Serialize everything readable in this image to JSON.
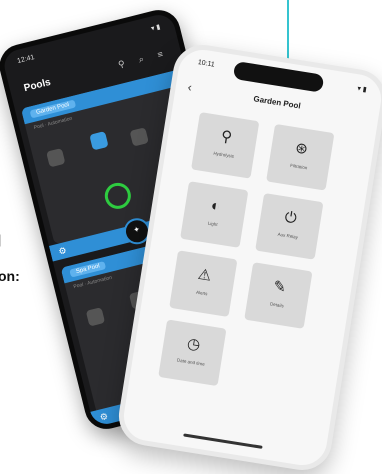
{
  "side_text": {
    "line1": "|",
    "line2": "on:"
  },
  "dark_phone": {
    "time": "12:41",
    "status_right": "▾ ▮",
    "title": "Pools",
    "header_icons": "⚲ ⌕ ≡",
    "card1": {
      "tag": "Garden Pool",
      "sub": "Pool · Automation"
    },
    "card2": {
      "tag": "Spa Pool",
      "sub": "Pool · Automation"
    },
    "ring_labels": [
      "",
      "",
      "",
      ""
    ],
    "settings_icon": "⚙",
    "fab_icon": "✦"
  },
  "light_phone": {
    "time": "10:11",
    "status_right": "▾ ▮",
    "back": "‹",
    "title": "Garden Pool",
    "tiles": [
      {
        "icon": "⚲",
        "label": "Hydrolysis"
      },
      {
        "icon": "⊛",
        "label": "Filtration"
      },
      {
        "icon": "◐",
        "label": "Light"
      },
      {
        "icon": "⏻",
        "label": "Aux Relay"
      },
      {
        "icon": "⚠",
        "label": "Alerts"
      },
      {
        "icon": "✎",
        "label": "Details"
      },
      {
        "icon": "◷",
        "label": "Date and time"
      }
    ]
  }
}
